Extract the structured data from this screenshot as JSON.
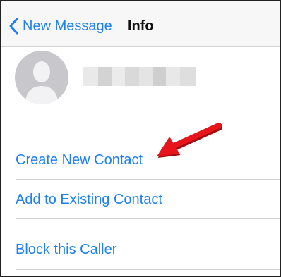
{
  "navbar": {
    "back_label": "New Message",
    "title": "Info"
  },
  "contact": {
    "name_redacted": true
  },
  "actions": [
    {
      "label": "Create New Contact"
    },
    {
      "label": "Add to Existing Contact"
    },
    {
      "label": "Block this Caller"
    }
  ],
  "colors": {
    "accent": "#1b7ff5",
    "annotation_arrow": "#e8141b",
    "avatar_bg": "#c7c7cc",
    "avatar_silhouette": "#f2f2f4"
  },
  "icons": {
    "back": "chevron-left-icon",
    "avatar": "person-silhouette-icon",
    "annotation": "red-arrow-icon"
  }
}
